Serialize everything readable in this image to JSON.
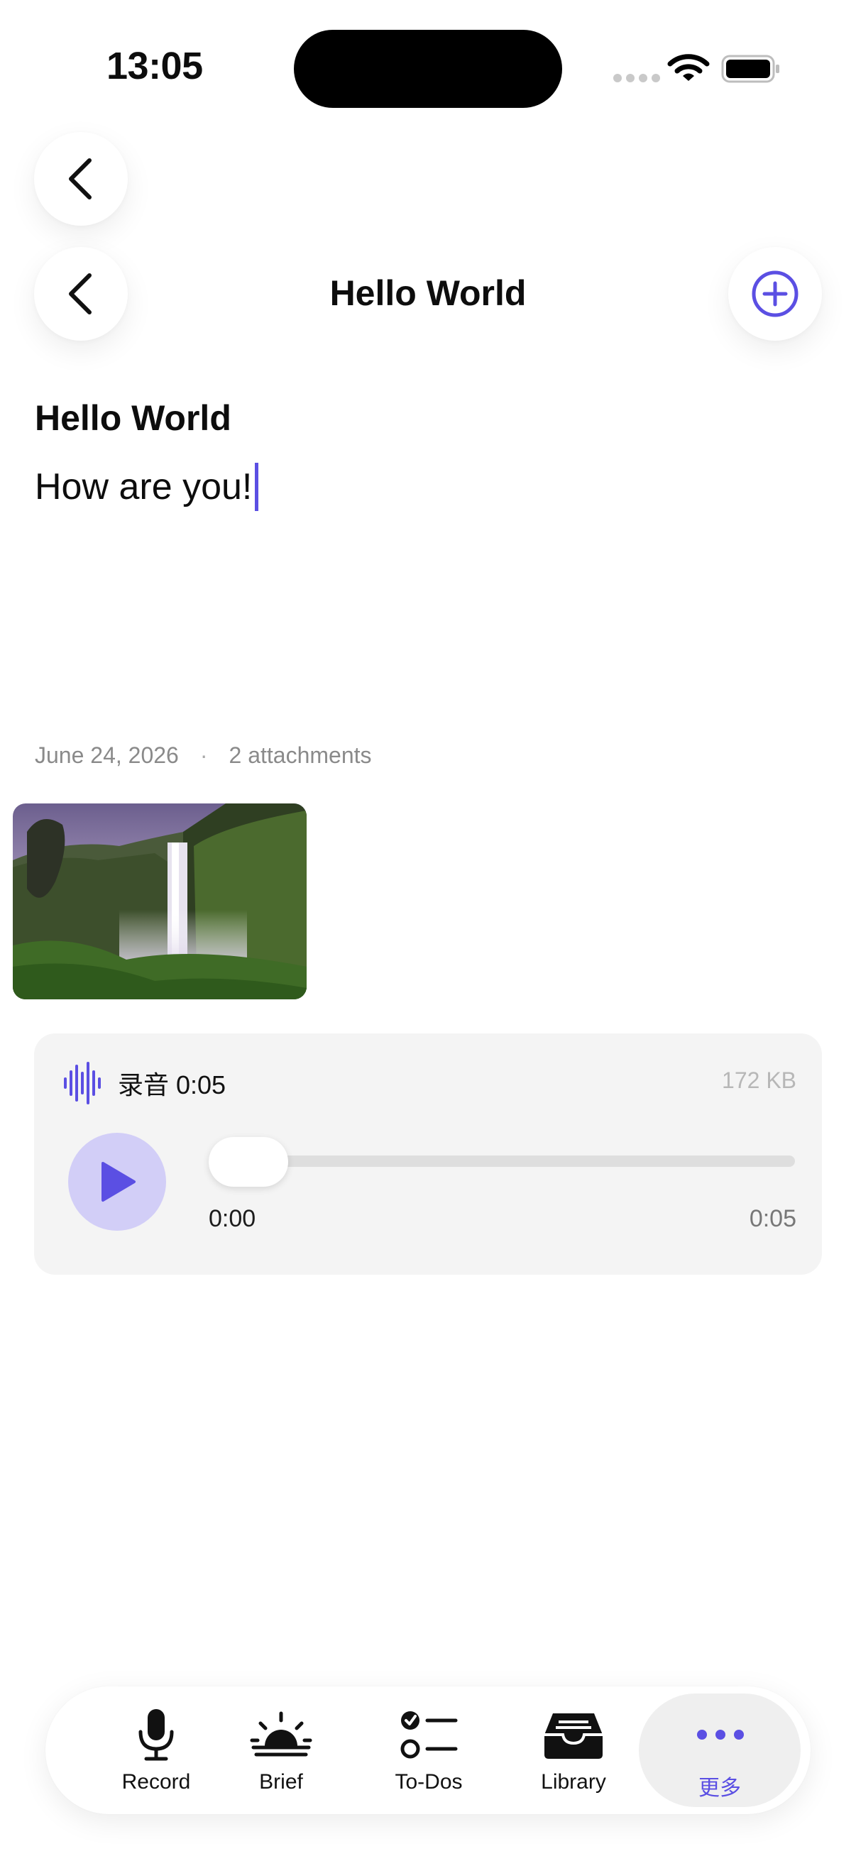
{
  "status_bar": {
    "time": "13:05"
  },
  "nav": {
    "title": "Hello World"
  },
  "note": {
    "title": "Hello World",
    "body": "How are you!",
    "date": "June 24, 2026",
    "separator": "·",
    "attachments_count": "2 attachments"
  },
  "audio": {
    "label": "录音 0:05",
    "size": "172 KB",
    "current_time": "0:00",
    "duration": "0:05",
    "progress": 0
  },
  "tab_bar": {
    "items": [
      {
        "label": "Record",
        "icon": "microphone-icon"
      },
      {
        "label": "Brief",
        "icon": "sunrise-icon"
      },
      {
        "label": "To-Dos",
        "icon": "checklist-icon"
      },
      {
        "label": "Library",
        "icon": "inbox-tray-icon"
      },
      {
        "label": "更多",
        "icon": "more-dots-icon",
        "selected": true
      }
    ]
  },
  "colors": {
    "accent": "#5b4fe3",
    "play_bg": "#d2cef7",
    "card_bg": "#f4f4f4"
  }
}
